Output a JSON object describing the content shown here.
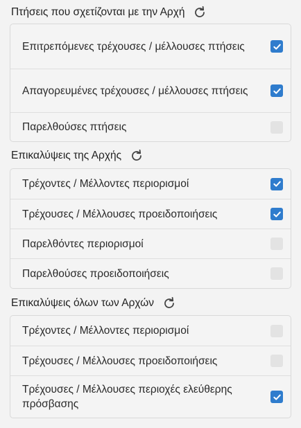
{
  "sections": [
    {
      "title": "Πτήσεις που σχετίζονται με την Αρχή",
      "rows": [
        {
          "label": "Επιτρεπόμενες τρέχουσες / μέλλουσες πτήσεις",
          "checked": true
        },
        {
          "label": "Απαγορευμένες τρέχουσες / μέλλουσες πτήσεις",
          "checked": true
        },
        {
          "label": "Παρελθούσες πτήσεις",
          "checked": false
        }
      ]
    },
    {
      "title": "Επικαλύψεις της Αρχής",
      "rows": [
        {
          "label": "Τρέχοντες / Μέλλοντες περιορισμοί",
          "checked": true
        },
        {
          "label": "Τρέχουσες / Μέλλουσες προειδοποιήσεις",
          "checked": true
        },
        {
          "label": "Παρελθόντες περιορισμοί",
          "checked": false
        },
        {
          "label": "Παρελθούσες προειδοποιήσεις",
          "checked": false
        }
      ]
    },
    {
      "title": "Επικαλύψεις όλων των Αρχών",
      "rows": [
        {
          "label": "Τρέχοντες / Μέλλοντες περιορισμοί",
          "checked": false
        },
        {
          "label": "Τρέχουσες / Μέλλουσες προειδοποιήσεις",
          "checked": false
        },
        {
          "label": "Τρέχουσες / Μέλλουσες περιοχές ελεύθερης πρόσβασης",
          "checked": true
        }
      ]
    }
  ],
  "icons": {
    "refresh": "refresh-icon",
    "check": "checkmark-icon"
  },
  "colors": {
    "checked": "#2f7ccd",
    "unchecked": "#e3e3e3"
  }
}
